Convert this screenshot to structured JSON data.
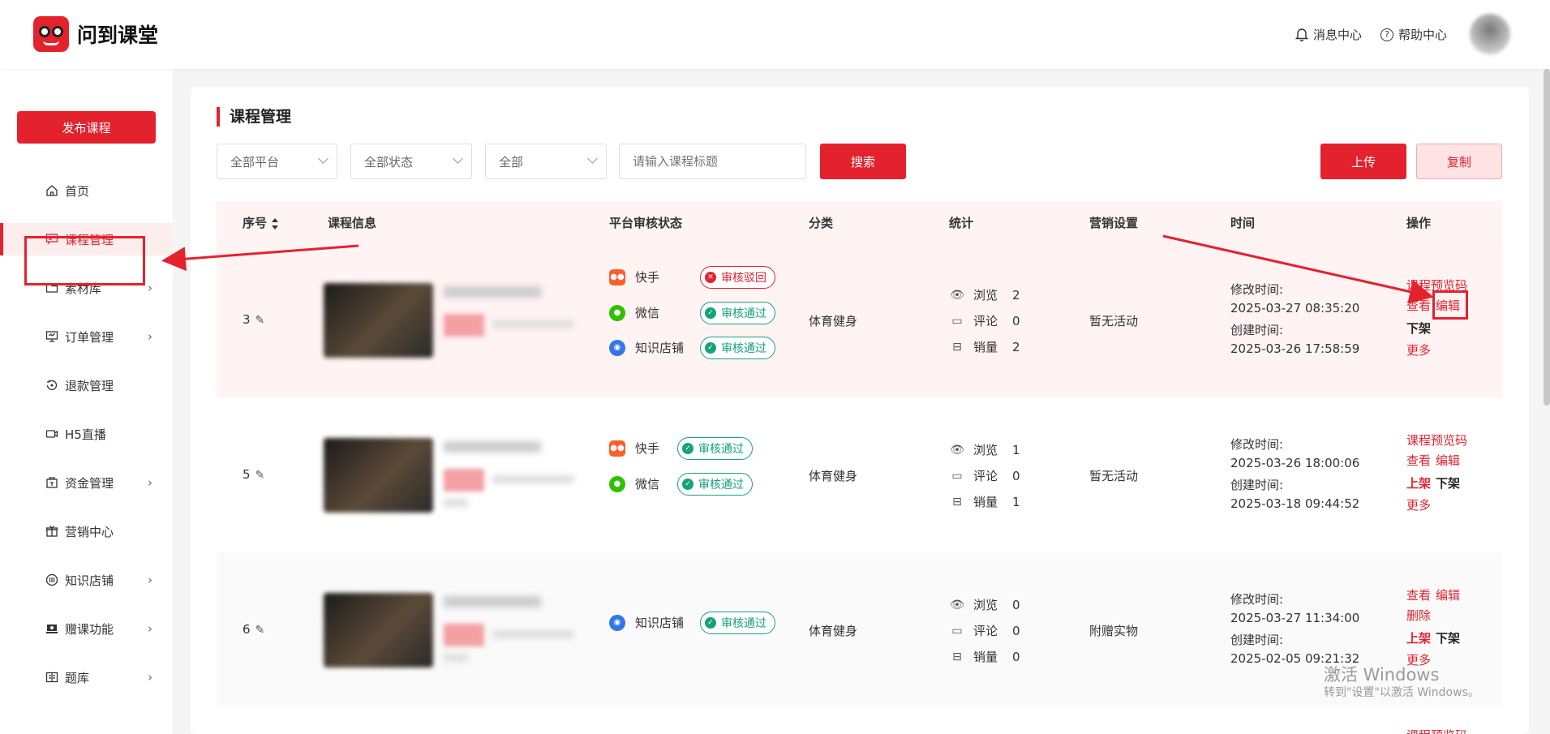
{
  "header": {
    "brand": "问到课堂",
    "message_center": "消息中心",
    "help_center": "帮助中心"
  },
  "sidebar": {
    "publish_label": "发布课程",
    "items": [
      {
        "label": "首页",
        "icon": "home-icon"
      },
      {
        "label": "课程管理",
        "icon": "course-icon"
      },
      {
        "label": "素材库",
        "icon": "folder-icon"
      },
      {
        "label": "订单管理",
        "icon": "order-icon"
      },
      {
        "label": "退款管理",
        "icon": "refund-icon"
      },
      {
        "label": "H5直播",
        "icon": "live-icon"
      },
      {
        "label": "资金管理",
        "icon": "wallet-icon"
      },
      {
        "label": "营销中心",
        "icon": "gift-icon"
      },
      {
        "label": "知识店铺",
        "icon": "shop-icon"
      },
      {
        "label": "赠课功能",
        "icon": "gift-course-icon"
      },
      {
        "label": "题库",
        "icon": "question-bank-icon"
      }
    ]
  },
  "main": {
    "title": "课程管理",
    "filters": {
      "platform": "全部平台",
      "status": "全部状态",
      "type": "全部",
      "search_placeholder": "请输入课程标题",
      "search_label": "搜索"
    },
    "upload_label": "上传",
    "copy_label": "复制",
    "columns": [
      "序号",
      "课程信息",
      "平台审核状态",
      "分类",
      "统计",
      "营销设置",
      "时间",
      "操作"
    ],
    "rows": [
      {
        "index": "3",
        "platforms": [
          {
            "name": "快手",
            "status": "审核驳回"
          },
          {
            "name": "微信",
            "status": "审核通过"
          },
          {
            "name": "知识店铺",
            "status": "审核通过"
          }
        ],
        "category": "体育健身",
        "stats": {
          "views_label": "浏览",
          "views": "2",
          "comments_label": "评论",
          "comments": "0",
          "sales_label": "销量",
          "sales": "2"
        },
        "marketing": "暂无活动",
        "modified_label": "修改时间:",
        "modified": "2025-03-27 08:35:20",
        "created_label": "创建时间:",
        "created": "2025-03-26 17:58:59",
        "ops": {
          "preview": "课程预览码",
          "view": "查看",
          "edit": "编辑",
          "delist": "下架",
          "more": "更多"
        }
      },
      {
        "index": "5",
        "platforms": [
          {
            "name": "快手",
            "status": "审核通过"
          },
          {
            "name": "微信",
            "status": "审核通过"
          }
        ],
        "category": "体育健身",
        "stats": {
          "views_label": "浏览",
          "views": "1",
          "comments_label": "评论",
          "comments": "0",
          "sales_label": "销量",
          "sales": "1"
        },
        "marketing": "暂无活动",
        "modified_label": "修改时间:",
        "modified": "2025-03-26 18:00:06",
        "created_label": "创建时间:",
        "created": "2025-03-18 09:44:52",
        "ops": {
          "preview": "课程预览码",
          "view": "查看",
          "edit": "编辑",
          "list": "上架",
          "delist": "下架",
          "more": "更多"
        }
      },
      {
        "index": "6",
        "platforms": [
          {
            "name": "知识店铺",
            "status": "审核通过"
          }
        ],
        "category": "体育健身",
        "stats": {
          "views_label": "浏览",
          "views": "0",
          "comments_label": "评论",
          "comments": "0",
          "sales_label": "销量",
          "sales": "0"
        },
        "marketing": "附赠实物",
        "modified_label": "修改时间:",
        "modified": "2025-03-27 11:34:00",
        "created_label": "创建时间:",
        "created": "2025-02-05 09:21:32",
        "ops": {
          "view": "查看",
          "edit": "编辑",
          "delete": "删除",
          "list": "上架",
          "delist": "下架",
          "more": "更多"
        }
      }
    ],
    "next_row_preview": "课程预览码"
  },
  "watermark": {
    "line1": "激活 Windows",
    "line2": "转到\"设置\"以激活 Windows。"
  },
  "colors": {
    "accent": "#e4222e",
    "approved": "#16a37a"
  }
}
